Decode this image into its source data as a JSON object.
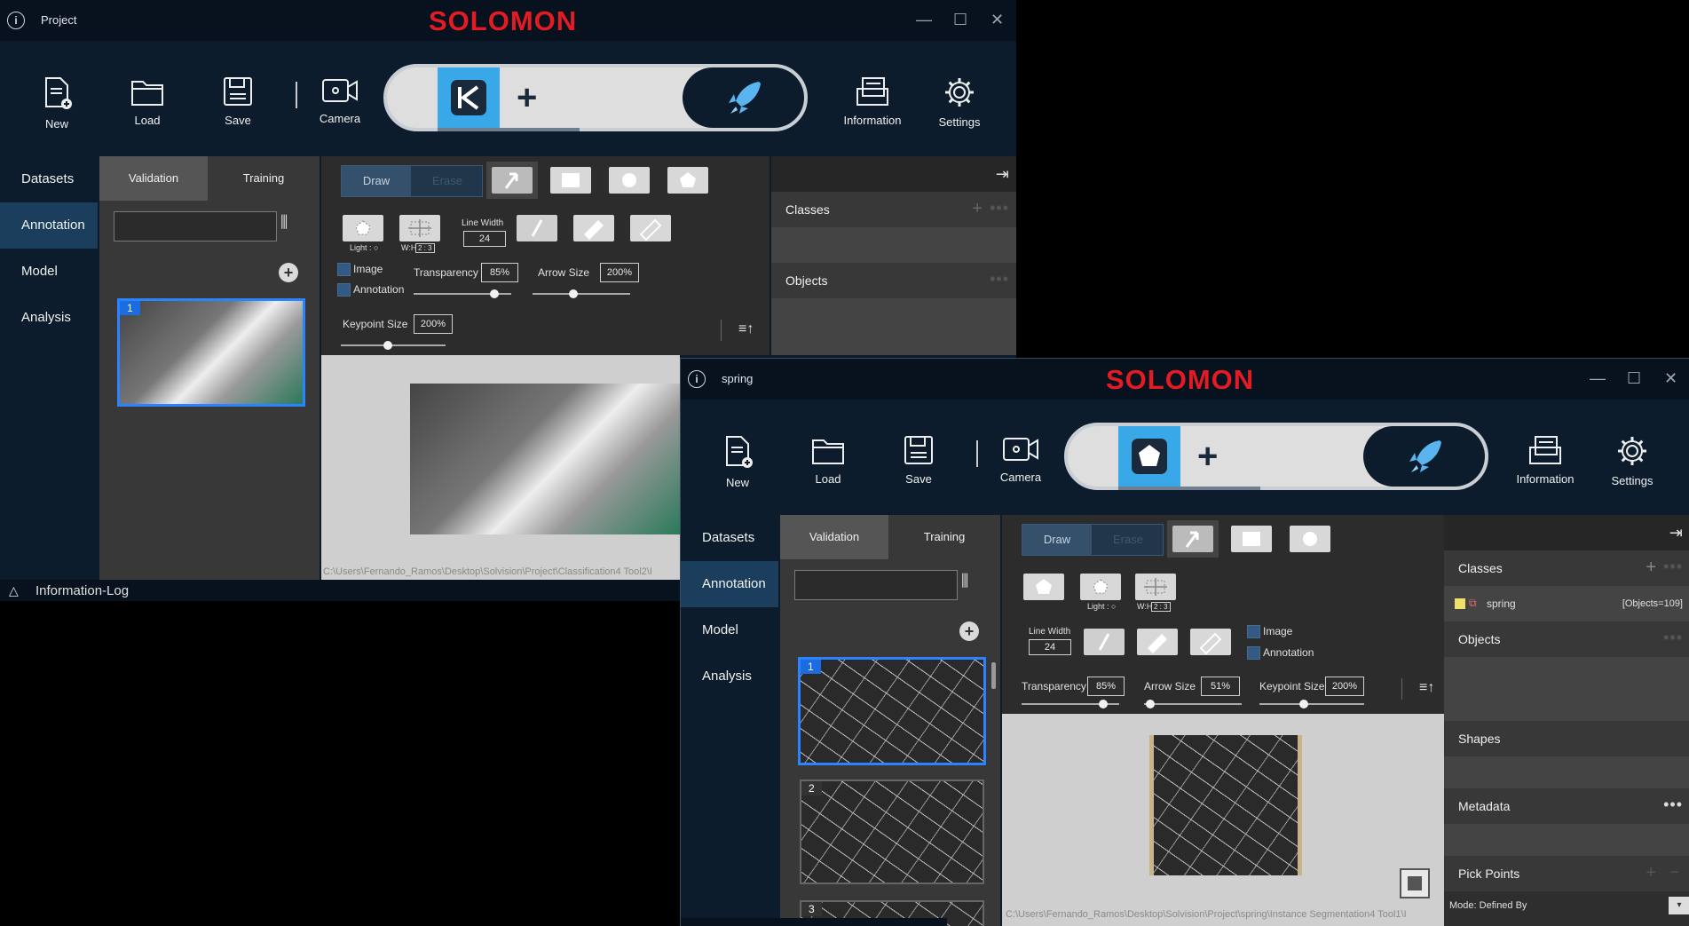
{
  "brand": "SOLOMON",
  "window_controls": {
    "minimize": "—",
    "maximize": "☐",
    "close": "✕"
  },
  "toolbar": {
    "new": "New",
    "load": "Load",
    "save": "Save",
    "camera": "Camera",
    "information": "Information",
    "settings": "Settings"
  },
  "nav": {
    "datasets": "Datasets",
    "annotation": "Annotation",
    "model": "Model",
    "analysis": "Analysis"
  },
  "tabs": {
    "validation": "Validation",
    "training": "Training"
  },
  "draw_toggle": {
    "draw": "Draw",
    "erase": "Erase"
  },
  "tools": {
    "light": "Light : ○",
    "wh": "W:H",
    "wh_values": "2 : 3",
    "line_width_label": "Line Width",
    "line_width_value": "24",
    "image_label": "Image",
    "annotation_label": "Annotation",
    "transparency_label": "Transparency",
    "arrow_size_label": "Arrow Size",
    "keypoint_size_label": "Keypoint Size"
  },
  "win1": {
    "title": "Project",
    "transparency_value": "85%",
    "arrow_size_value": "200%",
    "keypoint_size_value": "200%",
    "transparency_level": 0.83,
    "arrow_size_level": 0.42,
    "keypoint_size_level": 0.45,
    "thumbs": [
      "1"
    ],
    "path": "C:\\Users\\Fernando_Ramos\\Desktop\\Solvision\\Project\\Classification4 Tool2\\I",
    "classes_label": "Classes",
    "objects_label": "Objects",
    "status": "Information-Log"
  },
  "win2": {
    "title": "spring",
    "transparency_value": "85%",
    "arrow_size_value": "51%",
    "keypoint_size_value": "200%",
    "transparency_level": 0.84,
    "arrow_size_level": 0.06,
    "keypoint_size_level": 0.42,
    "thumbs": [
      "1",
      "2",
      "3"
    ],
    "path": "C:\\Users\\Fernando_Ramos\\Desktop\\Solvision\\Project\\spring\\Instance Segmentation4 Tool1\\I",
    "classes_label": "Classes",
    "class_item_name": "spring",
    "class_item_count": "[Objects=109]",
    "objects_label": "Objects",
    "shapes_label": "Shapes",
    "metadata_label": "Metadata",
    "pick_points_label": "Pick Points",
    "mode_label": "Mode: Defined By",
    "status": "Information-Log",
    "class_color": "#f0e06a"
  }
}
